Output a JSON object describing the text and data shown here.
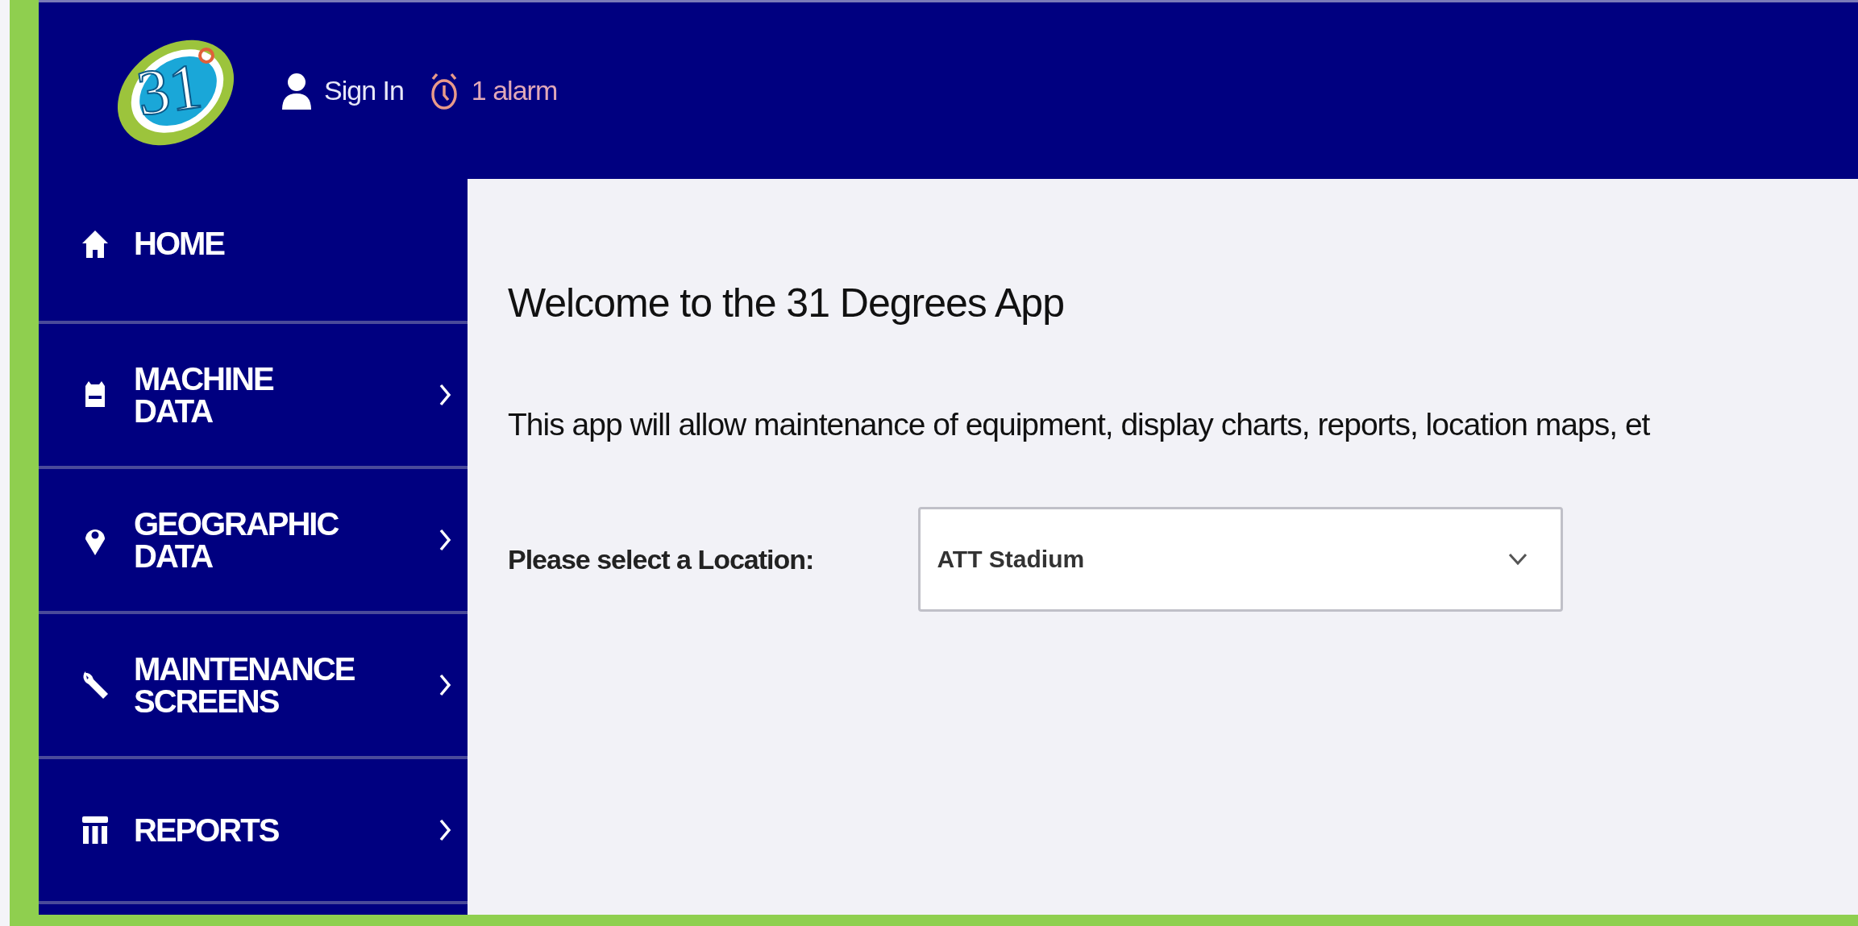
{
  "header": {
    "logo_text": "31",
    "sign_in": "Sign In",
    "alarm": "1 alarm"
  },
  "sidebar": {
    "items": [
      {
        "label": "HOME",
        "has_submenu": false
      },
      {
        "label": "MACHINE DATA",
        "has_submenu": true
      },
      {
        "label": "GEOGRAPHIC DATA",
        "has_submenu": true
      },
      {
        "label": "MAINTENANCE SCREENS",
        "has_submenu": true
      },
      {
        "label": "REPORTS",
        "has_submenu": true
      }
    ]
  },
  "main": {
    "title": "Welcome to the 31 Degrees App",
    "description": "This app will allow maintenance of equipment, display charts, reports, location maps, et",
    "location_label": "Please select a Location:",
    "location_value": "ATT Stadium"
  }
}
